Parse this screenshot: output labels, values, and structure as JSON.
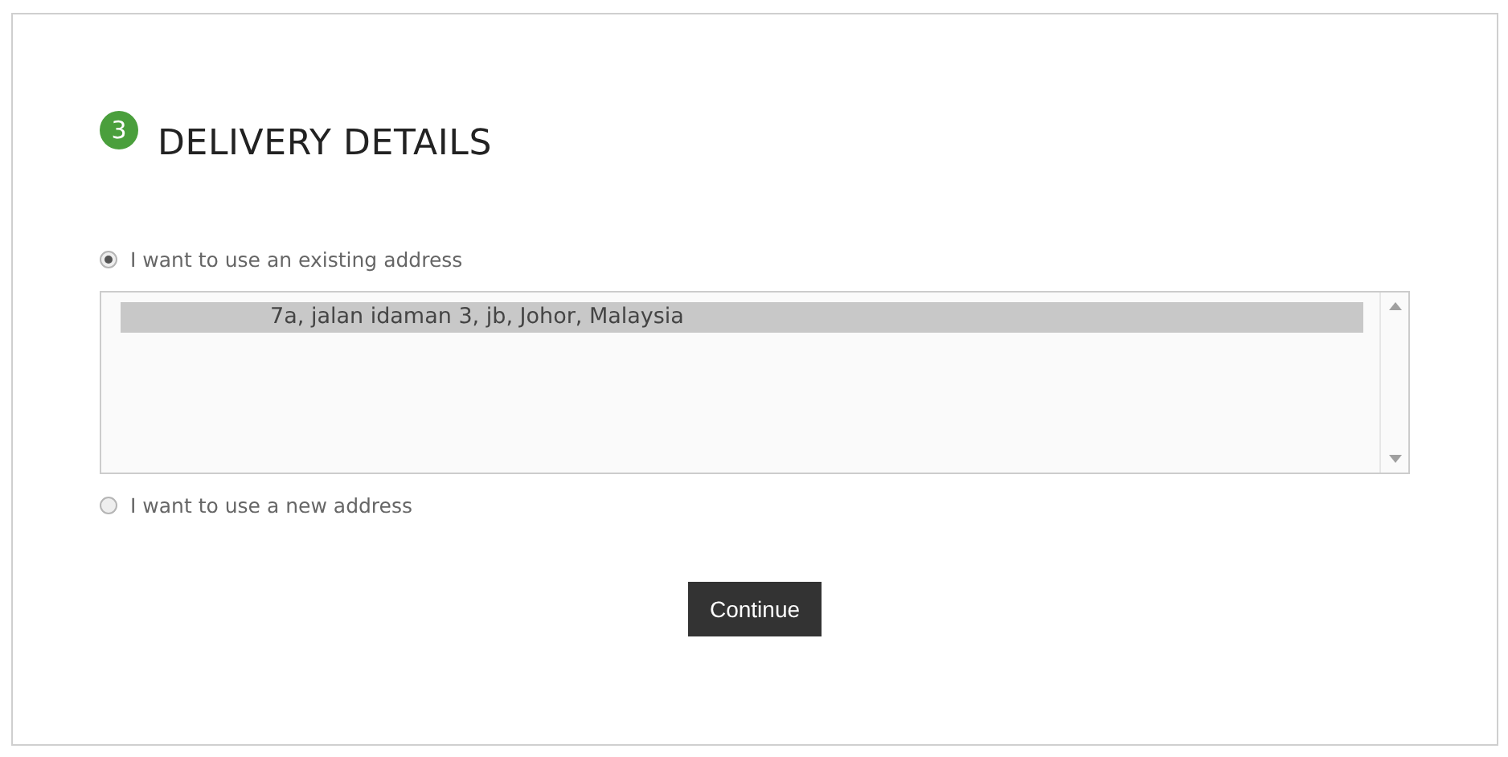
{
  "step": {
    "number": "3",
    "title": "DELIVERY DETAILS"
  },
  "options": [
    {
      "label": "I want to use an existing address",
      "selected": true
    },
    {
      "label": "I want to use a new address",
      "selected": false
    }
  ],
  "addresses": [
    {
      "text": "7a, jalan idaman 3, jb, Johor, Malaysia",
      "selected": true
    }
  ],
  "button": "Continue"
}
